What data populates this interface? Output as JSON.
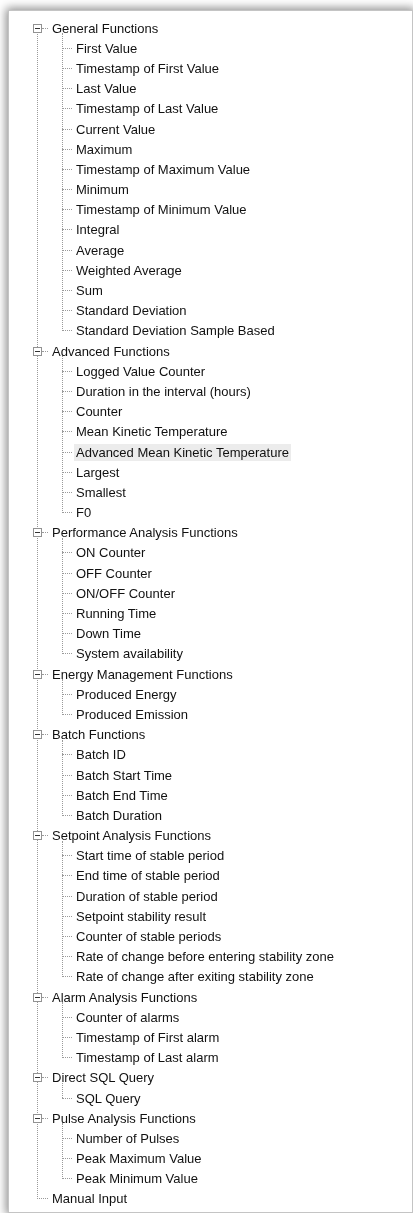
{
  "tree": {
    "items": [
      {
        "label": "General Functions",
        "expanded": true,
        "selected": false,
        "children": [
          {
            "label": "First Value",
            "selected": false
          },
          {
            "label": "Timestamp of First Value",
            "selected": false
          },
          {
            "label": "Last Value",
            "selected": false
          },
          {
            "label": "Timestamp of Last Value",
            "selected": false
          },
          {
            "label": "Current Value",
            "selected": false
          },
          {
            "label": "Maximum",
            "selected": false
          },
          {
            "label": "Timestamp of Maximum Value",
            "selected": false
          },
          {
            "label": "Minimum",
            "selected": false
          },
          {
            "label": "Timestamp of Minimum Value",
            "selected": false
          },
          {
            "label": "Integral",
            "selected": false
          },
          {
            "label": "Average",
            "selected": false
          },
          {
            "label": "Weighted Average",
            "selected": false
          },
          {
            "label": "Sum",
            "selected": false
          },
          {
            "label": "Standard Deviation",
            "selected": false
          },
          {
            "label": "Standard Deviation Sample Based",
            "selected": false
          }
        ]
      },
      {
        "label": "Advanced Functions",
        "expanded": true,
        "selected": false,
        "children": [
          {
            "label": "Logged Value Counter",
            "selected": false
          },
          {
            "label": "Duration in the interval (hours)",
            "selected": false
          },
          {
            "label": "Counter",
            "selected": false
          },
          {
            "label": "Mean Kinetic Temperature",
            "selected": false
          },
          {
            "label": "Advanced Mean Kinetic Temperature",
            "selected": true
          },
          {
            "label": "Largest",
            "selected": false
          },
          {
            "label": "Smallest",
            "selected": false
          },
          {
            "label": "F0",
            "selected": false
          }
        ]
      },
      {
        "label": "Performance Analysis Functions",
        "expanded": true,
        "selected": false,
        "children": [
          {
            "label": "ON Counter",
            "selected": false
          },
          {
            "label": "OFF Counter",
            "selected": false
          },
          {
            "label": "ON/OFF Counter",
            "selected": false
          },
          {
            "label": "Running Time",
            "selected": false
          },
          {
            "label": "Down Time",
            "selected": false
          },
          {
            "label": "System availability",
            "selected": false
          }
        ]
      },
      {
        "label": "Energy Management Functions",
        "expanded": true,
        "selected": false,
        "children": [
          {
            "label": "Produced Energy",
            "selected": false
          },
          {
            "label": "Produced Emission",
            "selected": false
          }
        ]
      },
      {
        "label": "Batch Functions",
        "expanded": true,
        "selected": false,
        "children": [
          {
            "label": "Batch ID",
            "selected": false
          },
          {
            "label": "Batch Start Time",
            "selected": false
          },
          {
            "label": "Batch End Time",
            "selected": false
          },
          {
            "label": "Batch Duration",
            "selected": false
          }
        ]
      },
      {
        "label": "Setpoint Analysis Functions",
        "expanded": true,
        "selected": false,
        "children": [
          {
            "label": "Start time of stable period",
            "selected": false
          },
          {
            "label": "End time of stable period",
            "selected": false
          },
          {
            "label": "Duration of stable period",
            "selected": false
          },
          {
            "label": "Setpoint stability result",
            "selected": false
          },
          {
            "label": "Counter of stable periods",
            "selected": false
          },
          {
            "label": "Rate of change before entering stability zone",
            "selected": false
          },
          {
            "label": "Rate of change after exiting stability zone",
            "selected": false
          }
        ]
      },
      {
        "label": "Alarm Analysis Functions",
        "expanded": true,
        "selected": false,
        "children": [
          {
            "label": "Counter of alarms",
            "selected": false
          },
          {
            "label": "Timestamp of First alarm",
            "selected": false
          },
          {
            "label": "Timestamp of Last alarm",
            "selected": false
          }
        ]
      },
      {
        "label": "Direct SQL Query",
        "expanded": true,
        "selected": false,
        "children": [
          {
            "label": "SQL Query",
            "selected": false
          }
        ]
      },
      {
        "label": "Pulse Analysis Functions",
        "expanded": true,
        "selected": false,
        "children": [
          {
            "label": "Number of Pulses",
            "selected": false
          },
          {
            "label": "Peak Maximum Value",
            "selected": false
          },
          {
            "label": "Peak Minimum Value",
            "selected": false
          }
        ]
      },
      {
        "label": "Manual Input",
        "selected": false
      }
    ]
  }
}
